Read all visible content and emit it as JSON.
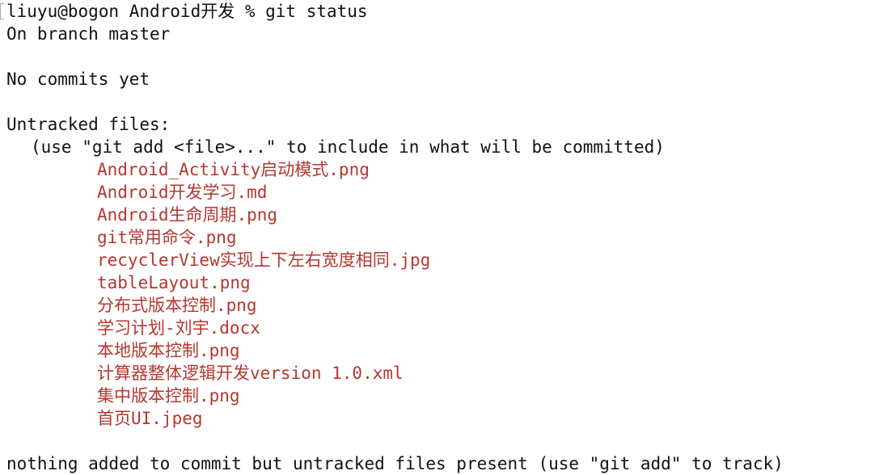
{
  "terminal": {
    "prompt": "liuyu@bogon Android开发 % git status",
    "branch_line": "On branch master",
    "commits_line": "No commits yet",
    "untracked_header": "Untracked files:",
    "untracked_hint": "(use \"git add <file>...\" to include in what will be committed)",
    "untracked_files": [
      "Android_Activity启动模式.png",
      "Android开发学习.md",
      "Android生命周期.png",
      "git常用命令.png",
      "recyclerView实现上下左右宽度相同.jpg",
      "tableLayout.png",
      "分布式版本控制.png",
      "学习计划-刘宇.docx",
      "本地版本控制.png",
      "计算器整体逻辑开发version 1.0.xml",
      "集中版本控制.png",
      "首页UI.jpeg"
    ],
    "footer": "nothing added to commit but untracked files present (use \"git add\" to track)"
  },
  "colors": {
    "background": "#ffffff",
    "text": "#111111",
    "untracked": "#b5372f"
  }
}
